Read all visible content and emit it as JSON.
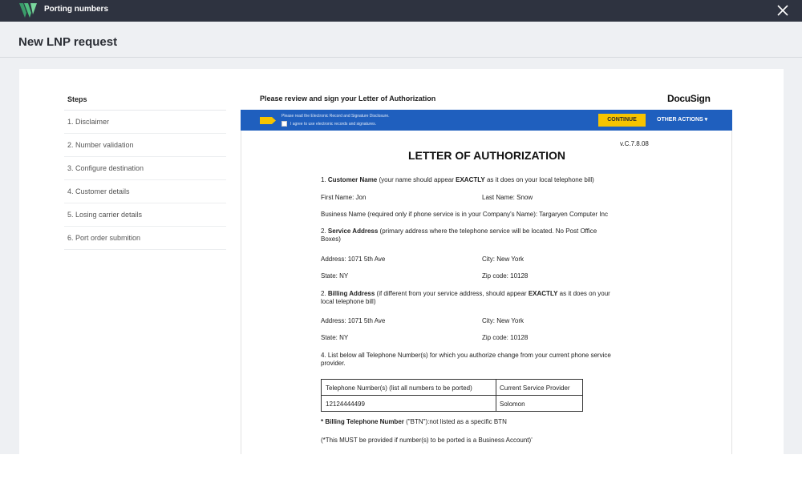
{
  "app": {
    "title": "Porting numbers"
  },
  "header": {
    "title": "New LNP request"
  },
  "steps": {
    "title": "Steps",
    "items": [
      {
        "label": "1. Disclaimer"
      },
      {
        "label": "2. Number validation"
      },
      {
        "label": "3. Configure destination"
      },
      {
        "label": "4. Customer details"
      },
      {
        "label": "5. Losing carrier details"
      },
      {
        "label": "6. Port order submition"
      }
    ]
  },
  "document": {
    "heading": "Please review and sign your Letter of Authorization",
    "provider_logo": "DocuSign",
    "docusign_bar": {
      "notice": "Please read the Electronic Record and Signature Disclosure.",
      "checkbox_label": "I agree to use electronic records and signatures.",
      "checkbox_checked": false,
      "continue_label": "CONTINUE",
      "other_actions_label": "OTHER ACTIONS ▾",
      "bar_color": "#1f5fbe",
      "accent_color": "#f6c400"
    },
    "letter": {
      "version": "v.C.7.8.08",
      "title": "LETTER OF AUTHORIZATION",
      "s1_num": "1.",
      "s1_title": "Customer Name",
      "s1_note_a": "(your name should appear",
      "s1_emph": "EXACTLY",
      "s1_note_b": "as it does on your local telephone bill)",
      "first_name": "First Name: Jon",
      "last_name": "Last Name: Snow",
      "business_name": "Business Name (required only if phone service is in your Company's Name): Targaryen Computer Inc",
      "s2_num": "2.",
      "s2_title": "Service Address",
      "s2_note_l1": "(primary address where the telephone service will be located. No Post Office",
      "s2_note_l2": "Boxes)",
      "svc_address": "Address: 1071 5th Ave",
      "svc_city": "City: New York",
      "svc_state": "State: NY",
      "svc_zip": "Zip code: 10128",
      "s3_num": "2.",
      "s3_title": "Billing Address",
      "s3_note_a": "(if different from your service address, should appear",
      "s3_emph": "EXACTLY",
      "s3_note_b": "as it does on your",
      "s3_note_l2": "local telephone bill)",
      "bill_address": "Address: 1071 5th Ave",
      "bill_city": "City: New York",
      "bill_state": "State: NY",
      "bill_zip": "Zip code: 10128",
      "s4_l1": "4. List below all Telephone Number(s) for which you authorize change from your current phone service",
      "s4_l2": "provider.",
      "table": {
        "headers": [
          "Telephone Number(s) (list all numbers to be ported)",
          "Current Service Provider"
        ],
        "rows": [
          [
            "12124444499",
            "Solomon"
          ]
        ]
      },
      "btn_star": "*",
      "btn_title": "Billing Telephone Number",
      "btn_note": "(\"BTN\"):not listed as a specific BTN",
      "btn_footnote": "(*This MUST be provided if number(s) to be ported is a Business Account)'"
    }
  }
}
